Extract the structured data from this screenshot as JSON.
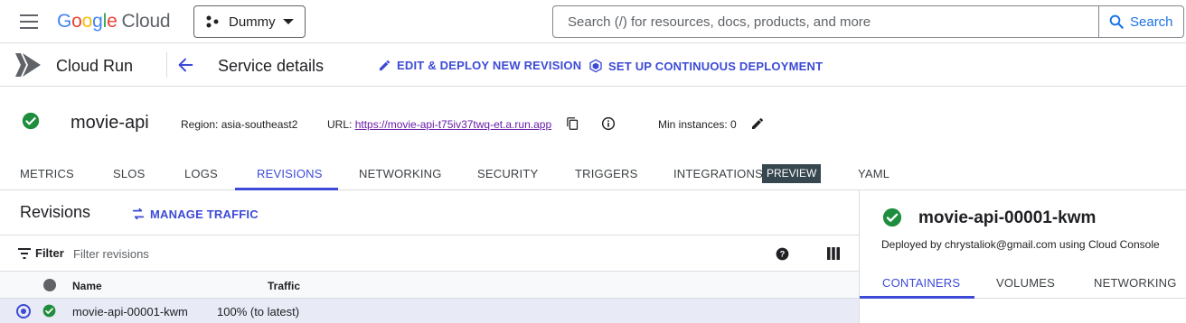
{
  "topbar": {
    "logo_letters": [
      "G",
      "o",
      "o",
      "g",
      "l",
      "e"
    ],
    "logo_product": "Cloud",
    "project": "Dummy",
    "search_placeholder": "Search (/) for resources, docs, products, and more",
    "search_button": "Search"
  },
  "service_bar": {
    "product": "Cloud Run",
    "title": "Service details",
    "actions": {
      "edit_deploy": "EDIT & DEPLOY NEW REVISION",
      "continuous_deployment": "SET UP CONTINUOUS DEPLOYMENT"
    }
  },
  "service": {
    "name": "movie-api",
    "region": "Region: asia-southeast2",
    "url_label": "URL: ",
    "url": "https://movie-api-t75iv37twq-et.a.run.app",
    "min_instances": "Min instances: 0",
    "status": "ok"
  },
  "tabs": [
    "METRICS",
    "SLOS",
    "LOGS",
    "REVISIONS",
    "NETWORKING",
    "SECURITY",
    "TRIGGERS",
    "INTEGRATIONS",
    "YAML"
  ],
  "active_tab": "REVISIONS",
  "preview_badge": "PREVIEW",
  "revisions": {
    "title": "Revisions",
    "manage_traffic": "MANAGE TRAFFIC",
    "filter_label": "Filter",
    "filter_placeholder": "Filter revisions",
    "columns": {
      "name": "Name",
      "traffic": "Traffic"
    },
    "rows": [
      {
        "name": "movie-api-00001-kwm",
        "traffic": "100% (to latest)",
        "selected": true,
        "status": "ok"
      }
    ]
  },
  "detail": {
    "revision_name": "movie-api-00001-kwm",
    "deployed_by": "Deployed by chrystaliok@gmail.com using Cloud Console",
    "tabs": [
      "CONTAINERS",
      "VOLUMES",
      "NETWORKING"
    ],
    "active_tab": "CONTAINERS"
  },
  "colors": {
    "accent": "#3c4ad6",
    "success": "#1e8e3e",
    "link_visited": "#681da8",
    "preview_badge_bg": "#37474f"
  }
}
